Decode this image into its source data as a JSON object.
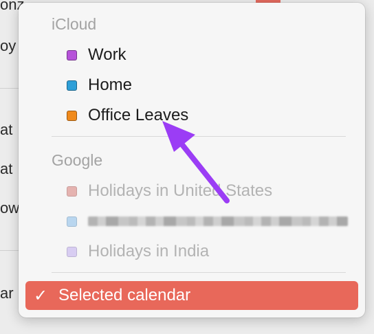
{
  "background": {
    "fragments": [
      "onz",
      "oy",
      "at",
      "at",
      "ow",
      "ar"
    ]
  },
  "menu": {
    "sections": [
      {
        "header": "iCloud",
        "items": [
          {
            "label": "Work",
            "color": "#b653d9",
            "enabled": true
          },
          {
            "label": "Home",
            "color": "#2e9fd8",
            "enabled": true
          },
          {
            "label": "Office Leaves",
            "color": "#f08a1c",
            "enabled": true
          }
        ]
      },
      {
        "header": "Google",
        "items": [
          {
            "label": "Holidays in United States",
            "color": "#e5b3b0",
            "enabled": false
          },
          {
            "label": "",
            "color": "#b9d6ef",
            "enabled": false,
            "redacted": true
          },
          {
            "label": "Holidays in India",
            "color": "#d8cdf2",
            "enabled": false
          }
        ]
      }
    ],
    "selected": {
      "check": "✓",
      "label": "Selected calendar"
    }
  },
  "colors": {
    "accent": "#e8685a",
    "annotation_arrow": "#9b3df5"
  }
}
